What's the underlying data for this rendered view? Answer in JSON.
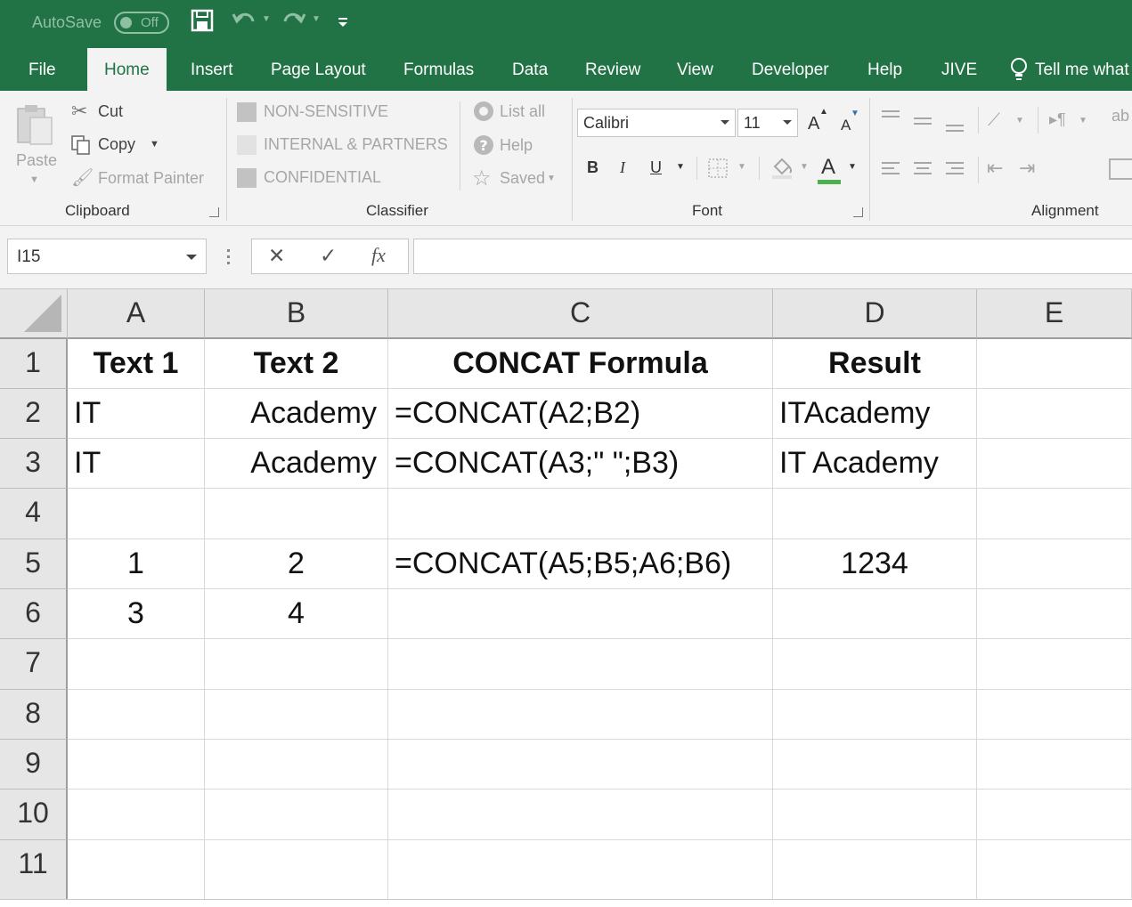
{
  "titlebar": {
    "autosave_label": "AutoSave",
    "autosave_state": "Off",
    "save_icon": "save-icon",
    "undo_icon": "undo-icon",
    "redo_icon": "redo-icon"
  },
  "tabs": [
    {
      "label": "File"
    },
    {
      "label": "Home"
    },
    {
      "label": "Insert"
    },
    {
      "label": "Page Layout"
    },
    {
      "label": "Formulas"
    },
    {
      "label": "Data"
    },
    {
      "label": "Review"
    },
    {
      "label": "View"
    },
    {
      "label": "Developer"
    },
    {
      "label": "Help"
    },
    {
      "label": "JIVE"
    }
  ],
  "tell_me": "Tell me what",
  "ribbon": {
    "clipboard": {
      "paste": "Paste",
      "cut": "Cut",
      "copy": "Copy",
      "format_painter": "Format Painter",
      "group_label": "Clipboard"
    },
    "classifier": {
      "items": [
        "NON-SENSITIVE",
        "INTERNAL & PARTNERS",
        "CONFIDENTIAL"
      ],
      "list_all": "List all",
      "help": "Help",
      "saved": "Saved",
      "group_label": "Classifier"
    },
    "font": {
      "name": "Calibri",
      "size": "11",
      "bold": "B",
      "italic": "I",
      "underline": "U",
      "font_color_letter": "A",
      "grow": "A",
      "shrink": "A",
      "group_label": "Font"
    },
    "alignment": {
      "group_label": "Alignment"
    }
  },
  "formula_bar": {
    "name_box": "I15",
    "cancel": "✕",
    "enter": "✓",
    "fx": "fx",
    "content": ""
  },
  "sheet": {
    "columns": [
      "A",
      "B",
      "C",
      "D",
      "E"
    ],
    "rows": [
      "1",
      "2",
      "3",
      "4",
      "5",
      "6",
      "7",
      "8",
      "9",
      "10",
      "11"
    ],
    "cells": {
      "A1": "Text 1",
      "B1": "Text 2",
      "C1": "CONCAT Formula",
      "D1": "Result",
      "A2": "IT",
      "B2": "Academy",
      "C2": "=CONCAT(A2;B2)",
      "D2": "ITAcademy",
      "A3": "IT",
      "B3": "Academy",
      "C3": "=CONCAT(A3;\" \";B3)",
      "D3": "IT Academy",
      "A5": "1",
      "B5": "2",
      "C5": "=CONCAT(A5;B5;A6;B6)",
      "D5": "1234",
      "A6": "3",
      "B6": "4"
    }
  }
}
